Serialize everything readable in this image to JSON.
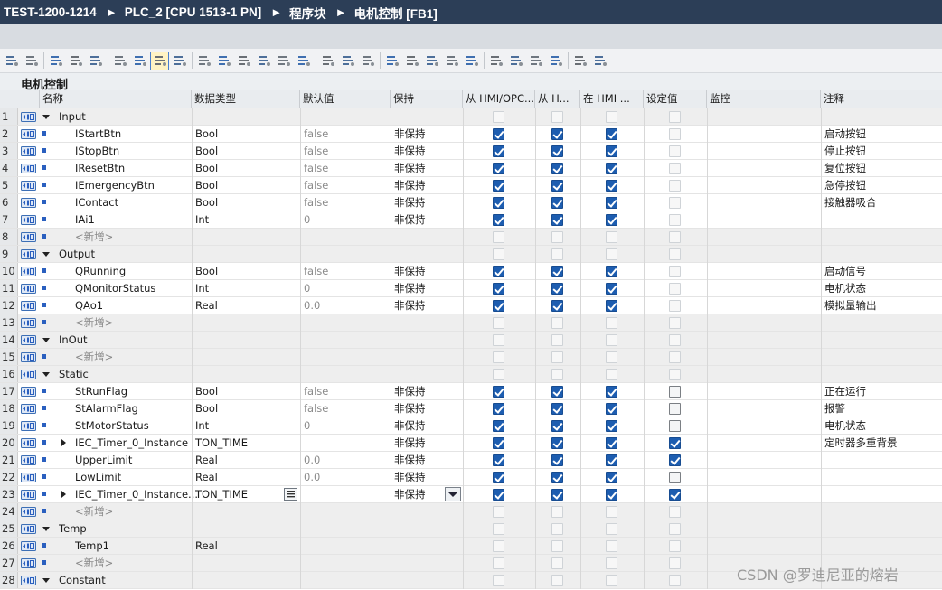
{
  "breadcrumb": {
    "items": [
      "TEST-1200-1214",
      "PLC_2 [CPU 1513-1 PN]",
      "程序块",
      "电机控制 [FB1]"
    ],
    "separator": "►"
  },
  "toolbar_icons": [
    "insert-row-icon",
    "add-row-icon",
    "add-block-icon",
    "export-icon",
    "monitor-icon",
    "expand-icon",
    "collapse-icon",
    "download-icon",
    "snapshot-icon",
    "copy-snapshot-icon",
    "paste-snapshot-icon",
    "load-snapshot-icon",
    "set-start-values-icon",
    "init-start-values-icon",
    "reset-icon",
    "indent-icon",
    "outdent-icon",
    "align-icon",
    "column-icon",
    "show-icon",
    "hide-icon",
    "settings-icon",
    "breakpoint-icon",
    "step-icon",
    "go-icon",
    "test-icon",
    "watch-icon",
    "force-icon",
    "database-icon"
  ],
  "block_title": "电机控制",
  "columns": [
    "名称",
    "数据类型",
    "默认值",
    "保持",
    "从 HMI/OPC...",
    "从 H...",
    "在 HMI ...",
    "设定值",
    "监控",
    "注释"
  ],
  "rows": [
    {
      "n": "1",
      "name": "Input",
      "type": "",
      "default": "",
      "retain": "",
      "section": true,
      "a": false,
      "b": false,
      "c": false,
      "d": false,
      "comment": ""
    },
    {
      "n": "2",
      "name": "IStartBtn",
      "type": "Bool",
      "default": "false",
      "retain": "非保持",
      "a": true,
      "b": true,
      "c": true,
      "d": false,
      "comment": "启动按钮"
    },
    {
      "n": "3",
      "name": "IStopBtn",
      "type": "Bool",
      "default": "false",
      "retain": "非保持",
      "a": true,
      "b": true,
      "c": true,
      "d": false,
      "comment": "停止按钮"
    },
    {
      "n": "4",
      "name": "IResetBtn",
      "type": "Bool",
      "default": "false",
      "retain": "非保持",
      "a": true,
      "b": true,
      "c": true,
      "d": false,
      "comment": "复位按钮"
    },
    {
      "n": "5",
      "name": "IEmergencyBtn",
      "type": "Bool",
      "default": "false",
      "retain": "非保持",
      "a": true,
      "b": true,
      "c": true,
      "d": false,
      "comment": "急停按钮"
    },
    {
      "n": "6",
      "name": "IContact",
      "type": "Bool",
      "default": "false",
      "retain": "非保持",
      "a": true,
      "b": true,
      "c": true,
      "d": false,
      "comment": "接触器吸合"
    },
    {
      "n": "7",
      "name": "IAi1",
      "type": "Int",
      "default": "0",
      "retain": "非保持",
      "a": true,
      "b": true,
      "c": true,
      "d": false,
      "comment": ""
    },
    {
      "n": "8",
      "name": "<新增>",
      "type": "",
      "default": "",
      "retain": "",
      "newrow": true,
      "a": false,
      "b": false,
      "c": false,
      "d": false,
      "comment": ""
    },
    {
      "n": "9",
      "name": "Output",
      "type": "",
      "default": "",
      "retain": "",
      "section": true,
      "a": false,
      "b": false,
      "c": false,
      "d": false,
      "comment": ""
    },
    {
      "n": "10",
      "name": "QRunning",
      "type": "Bool",
      "default": "false",
      "retain": "非保持",
      "a": true,
      "b": true,
      "c": true,
      "d": false,
      "comment": "启动信号"
    },
    {
      "n": "11",
      "name": "QMonitorStatus",
      "type": "Int",
      "default": "0",
      "retain": "非保持",
      "a": true,
      "b": true,
      "c": true,
      "d": false,
      "comment": "电机状态"
    },
    {
      "n": "12",
      "name": "QAo1",
      "type": "Real",
      "default": "0.0",
      "retain": "非保持",
      "a": true,
      "b": true,
      "c": true,
      "d": false,
      "comment": "模拟量输出"
    },
    {
      "n": "13",
      "name": "<新增>",
      "type": "",
      "default": "",
      "retain": "",
      "newrow": true,
      "a": false,
      "b": false,
      "c": false,
      "d": false,
      "comment": ""
    },
    {
      "n": "14",
      "name": "InOut",
      "type": "",
      "default": "",
      "retain": "",
      "section": true,
      "a": false,
      "b": false,
      "c": false,
      "d": false,
      "comment": ""
    },
    {
      "n": "15",
      "name": "<新增>",
      "type": "",
      "default": "",
      "retain": "",
      "newrow": true,
      "a": false,
      "b": false,
      "c": false,
      "d": false,
      "comment": ""
    },
    {
      "n": "16",
      "name": "Static",
      "type": "",
      "default": "",
      "retain": "",
      "section": true,
      "a": false,
      "b": false,
      "c": false,
      "d": false,
      "comment": ""
    },
    {
      "n": "17",
      "name": "StRunFlag",
      "type": "Bool",
      "default": "false",
      "retain": "非保持",
      "a": true,
      "b": true,
      "c": true,
      "d": false,
      "dk": true,
      "comment": "正在运行"
    },
    {
      "n": "18",
      "name": "StAlarmFlag",
      "type": "Bool",
      "default": "false",
      "retain": "非保持",
      "a": true,
      "b": true,
      "c": true,
      "d": false,
      "dk": true,
      "comment": "报警"
    },
    {
      "n": "19",
      "name": "StMotorStatus",
      "type": "Int",
      "default": "0",
      "retain": "非保持",
      "a": true,
      "b": true,
      "c": true,
      "d": false,
      "dk": true,
      "comment": "电机状态"
    },
    {
      "n": "20",
      "name": "IEC_Timer_0_Instance",
      "type": "TON_TIME",
      "default": "",
      "retain": "非保持",
      "expand": true,
      "a": true,
      "b": true,
      "c": true,
      "d": true,
      "comment": "定时器多重背景"
    },
    {
      "n": "21",
      "name": "UpperLimit",
      "type": "Real",
      "default": "0.0",
      "retain": "非保持",
      "a": true,
      "b": true,
      "c": true,
      "d": true,
      "comment": ""
    },
    {
      "n": "22",
      "name": "LowLimit",
      "type": "Real",
      "default": "0.0",
      "retain": "非保持",
      "a": true,
      "b": true,
      "c": true,
      "d": false,
      "dk": true,
      "comment": ""
    },
    {
      "n": "23",
      "name": "IEC_Timer_0_Instance...",
      "type": "TON_TIME",
      "default": "",
      "retain": "非保持",
      "expand": true,
      "editing": true,
      "a": true,
      "b": true,
      "c": true,
      "d": true,
      "comment": ""
    },
    {
      "n": "24",
      "name": "<新增>",
      "type": "",
      "default": "",
      "retain": "",
      "newrow": true,
      "a": false,
      "b": false,
      "c": false,
      "d": false,
      "comment": ""
    },
    {
      "n": "25",
      "name": "Temp",
      "type": "",
      "default": "",
      "retain": "",
      "section": true,
      "a": false,
      "b": false,
      "c": false,
      "d": false,
      "comment": ""
    },
    {
      "n": "26",
      "name": "Temp1",
      "type": "Real",
      "default": "",
      "retain": "",
      "a": false,
      "b": false,
      "c": false,
      "d": false,
      "comment": ""
    },
    {
      "n": "27",
      "name": "<新增>",
      "type": "",
      "default": "",
      "retain": "",
      "newrow": true,
      "a": false,
      "b": false,
      "c": false,
      "d": false,
      "comment": ""
    },
    {
      "n": "28",
      "name": "Constant",
      "type": "",
      "default": "",
      "retain": "",
      "section": true,
      "a": false,
      "b": false,
      "c": false,
      "d": false,
      "comment": ""
    }
  ],
  "watermark": "CSDN @罗迪尼亚的熔岩",
  "colors": {
    "title_bg": "#2c3e57",
    "checkbox_on": "#1d5db0",
    "accent_bullet": "#2a5fbf"
  }
}
